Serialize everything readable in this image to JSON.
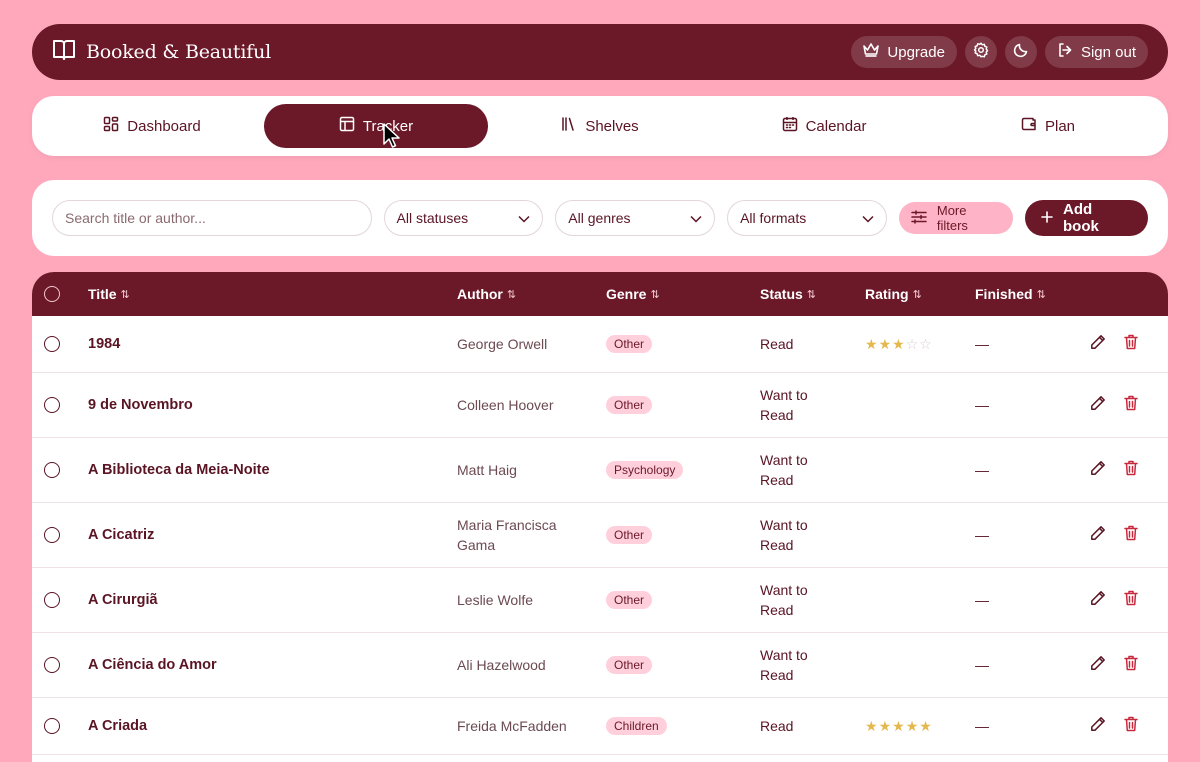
{
  "app": {
    "title": "Booked & Beautiful"
  },
  "header": {
    "upgrade_label": "Upgrade",
    "signout_label": "Sign out"
  },
  "nav": {
    "tabs": [
      {
        "label": "Dashboard",
        "icon": "dashboard-icon"
      },
      {
        "label": "Tracker",
        "icon": "table-icon",
        "active": true
      },
      {
        "label": "Shelves",
        "icon": "books-icon"
      },
      {
        "label": "Calendar",
        "icon": "calendar-icon"
      },
      {
        "label": "Plan",
        "icon": "wallet-icon"
      }
    ]
  },
  "filters": {
    "search_placeholder": "Search title or author...",
    "status": "All statuses",
    "genre": "All genres",
    "format": "All formats",
    "more_label": "More filters",
    "add_label": "Add book"
  },
  "table": {
    "columns": [
      "Title",
      "Author",
      "Genre",
      "Status",
      "Rating",
      "Finished"
    ],
    "rows": [
      {
        "title": "1984",
        "author": "George Orwell",
        "genre": "Other",
        "status": "Read",
        "rating": 3,
        "finished": "—"
      },
      {
        "title": "9 de Novembro",
        "author": "Colleen Hoover",
        "genre": "Other",
        "status": "Want to Read",
        "rating": 0,
        "finished": "—"
      },
      {
        "title": "A Biblioteca da Meia-Noite",
        "author": "Matt Haig",
        "genre": "Psychology",
        "status": "Want to Read",
        "rating": 0,
        "finished": "—"
      },
      {
        "title": "A Cicatriz",
        "author": "Maria Francisca Gama",
        "genre": "Other",
        "status": "Want to Read",
        "rating": 0,
        "finished": "—"
      },
      {
        "title": "A Cirurgiã",
        "author": "Leslie Wolfe",
        "genre": "Other",
        "status": "Want to Read",
        "rating": 0,
        "finished": "—"
      },
      {
        "title": "A Ciência do Amor",
        "author": "Ali Hazelwood",
        "genre": "Other",
        "status": "Want to Read",
        "rating": 0,
        "finished": "—"
      },
      {
        "title": "A Criada",
        "author": "Freida McFadden",
        "genre": "Children",
        "status": "Read",
        "rating": 5,
        "finished": "—"
      }
    ]
  },
  "colors": {
    "primary": "#6b1828",
    "background": "#ffa8bc",
    "badge": "#ffd0dc",
    "star": "#e5b84e"
  }
}
